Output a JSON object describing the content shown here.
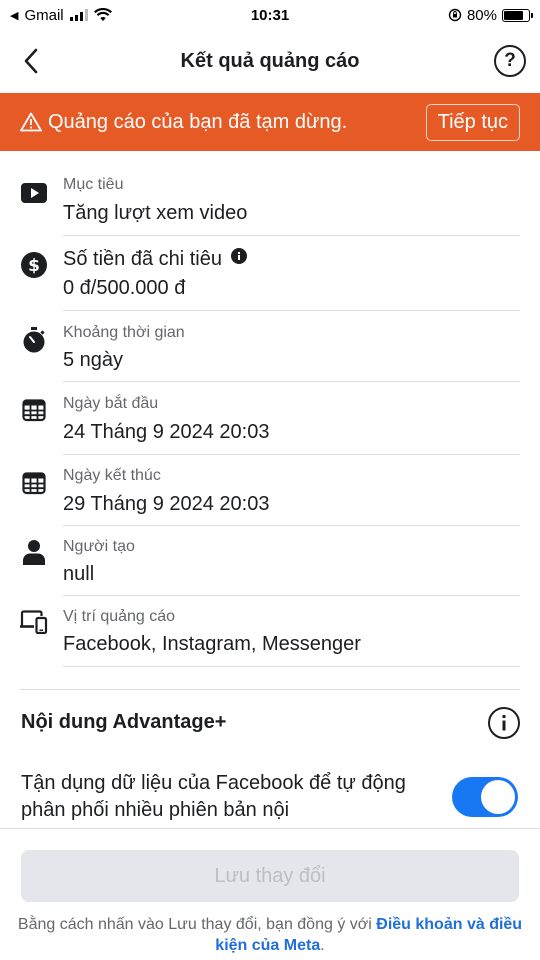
{
  "status_bar": {
    "carrier": "Gmail",
    "time": "10:31",
    "battery": "80%",
    "battery_level": 0.8
  },
  "header": {
    "title": "Kết quả quảng cáo",
    "back_icon": "chevron-left-icon",
    "help_icon": "question-circle-icon",
    "help_glyph": "?"
  },
  "banner": {
    "text": "Quảng cáo của bạn đã tạm dừng.",
    "icon": "warning-icon",
    "button_label": "Tiếp tục",
    "color": "#e65a26"
  },
  "details": {
    "objective": {
      "label": "Mục tiêu",
      "value": "Tăng lượt xem video",
      "icon": "play-icon"
    },
    "spend": {
      "label": "Số tiền đã chi tiêu",
      "value": "0 đ/500.000 đ",
      "icon": "dollar-icon",
      "info_icon": "info-icon"
    },
    "duration": {
      "label": "Khoảng thời gian",
      "value": "5 ngày",
      "icon": "stopwatch-icon"
    },
    "start_date": {
      "label": "Ngày bắt đầu",
      "value": "24 Tháng 9 2024 20:03",
      "icon": "calendar-icon"
    },
    "end_date": {
      "label": "Ngày kết thúc",
      "value": "29 Tháng 9 2024 20:03",
      "icon": "calendar-icon"
    },
    "creator": {
      "label": "Người tạo",
      "value": "null",
      "icon": "person-icon"
    },
    "placement": {
      "label": "Vị trí quảng cáo",
      "value": "Facebook, Instagram, Messenger",
      "icon": "devices-icon"
    }
  },
  "advantage": {
    "title": "Nội dung Advantage+",
    "info_icon": "info-circle-icon",
    "description": "Tận dụng dữ liệu của Facebook để tự động phân phối nhiều phiên bản nội",
    "toggle_on": true,
    "toggle_color": "#1877f2"
  },
  "footer": {
    "save_label": "Lưu thay đổi",
    "terms_prefix": "Bằng cách nhấn vào Lưu thay đổi, bạn đồng ý với ",
    "terms_link": "Điều khoản và điều kiện của Meta",
    "terms_suffix": ".",
    "link_color": "#216fdb"
  }
}
